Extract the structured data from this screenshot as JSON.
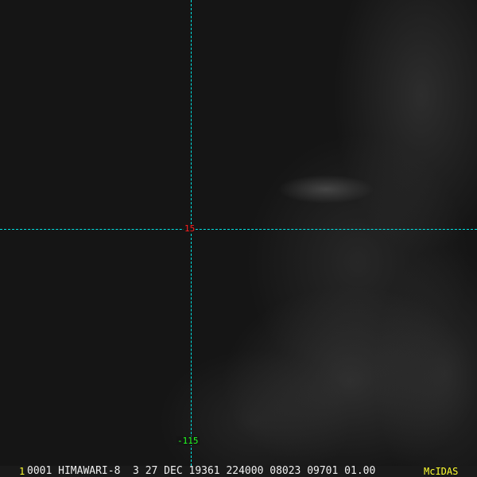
{
  "grid": {
    "latitude_label": "15",
    "longitude_label": "-115",
    "line_color": "#00e5e5"
  },
  "footer": {
    "frame_number": "1",
    "info": "0001 HIMAWARI-8  3 27 DEC 19361 224000 08023 09701 01.00",
    "brand": "McIDAS"
  }
}
